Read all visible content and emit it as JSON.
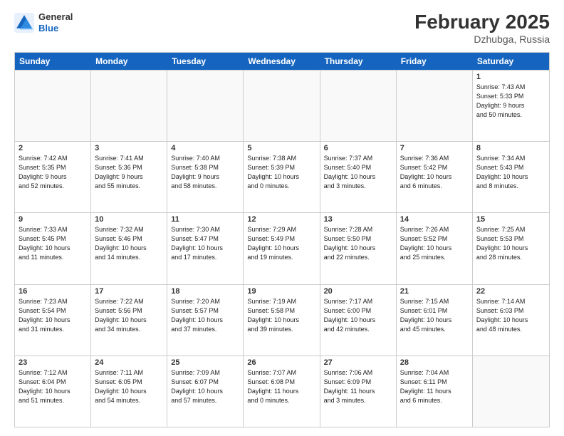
{
  "header": {
    "logo_general": "General",
    "logo_blue": "Blue",
    "month_year": "February 2025",
    "location": "Dzhubga, Russia"
  },
  "weekdays": [
    "Sunday",
    "Monday",
    "Tuesday",
    "Wednesday",
    "Thursday",
    "Friday",
    "Saturday"
  ],
  "weeks": [
    [
      {
        "day": "",
        "info": ""
      },
      {
        "day": "",
        "info": ""
      },
      {
        "day": "",
        "info": ""
      },
      {
        "day": "",
        "info": ""
      },
      {
        "day": "",
        "info": ""
      },
      {
        "day": "",
        "info": ""
      },
      {
        "day": "1",
        "info": "Sunrise: 7:43 AM\nSunset: 5:33 PM\nDaylight: 9 hours\nand 50 minutes."
      }
    ],
    [
      {
        "day": "2",
        "info": "Sunrise: 7:42 AM\nSunset: 5:35 PM\nDaylight: 9 hours\nand 52 minutes."
      },
      {
        "day": "3",
        "info": "Sunrise: 7:41 AM\nSunset: 5:36 PM\nDaylight: 9 hours\nand 55 minutes."
      },
      {
        "day": "4",
        "info": "Sunrise: 7:40 AM\nSunset: 5:38 PM\nDaylight: 9 hours\nand 58 minutes."
      },
      {
        "day": "5",
        "info": "Sunrise: 7:38 AM\nSunset: 5:39 PM\nDaylight: 10 hours\nand 0 minutes."
      },
      {
        "day": "6",
        "info": "Sunrise: 7:37 AM\nSunset: 5:40 PM\nDaylight: 10 hours\nand 3 minutes."
      },
      {
        "day": "7",
        "info": "Sunrise: 7:36 AM\nSunset: 5:42 PM\nDaylight: 10 hours\nand 6 minutes."
      },
      {
        "day": "8",
        "info": "Sunrise: 7:34 AM\nSunset: 5:43 PM\nDaylight: 10 hours\nand 8 minutes."
      }
    ],
    [
      {
        "day": "9",
        "info": "Sunrise: 7:33 AM\nSunset: 5:45 PM\nDaylight: 10 hours\nand 11 minutes."
      },
      {
        "day": "10",
        "info": "Sunrise: 7:32 AM\nSunset: 5:46 PM\nDaylight: 10 hours\nand 14 minutes."
      },
      {
        "day": "11",
        "info": "Sunrise: 7:30 AM\nSunset: 5:47 PM\nDaylight: 10 hours\nand 17 minutes."
      },
      {
        "day": "12",
        "info": "Sunrise: 7:29 AM\nSunset: 5:49 PM\nDaylight: 10 hours\nand 19 minutes."
      },
      {
        "day": "13",
        "info": "Sunrise: 7:28 AM\nSunset: 5:50 PM\nDaylight: 10 hours\nand 22 minutes."
      },
      {
        "day": "14",
        "info": "Sunrise: 7:26 AM\nSunset: 5:52 PM\nDaylight: 10 hours\nand 25 minutes."
      },
      {
        "day": "15",
        "info": "Sunrise: 7:25 AM\nSunset: 5:53 PM\nDaylight: 10 hours\nand 28 minutes."
      }
    ],
    [
      {
        "day": "16",
        "info": "Sunrise: 7:23 AM\nSunset: 5:54 PM\nDaylight: 10 hours\nand 31 minutes."
      },
      {
        "day": "17",
        "info": "Sunrise: 7:22 AM\nSunset: 5:56 PM\nDaylight: 10 hours\nand 34 minutes."
      },
      {
        "day": "18",
        "info": "Sunrise: 7:20 AM\nSunset: 5:57 PM\nDaylight: 10 hours\nand 37 minutes."
      },
      {
        "day": "19",
        "info": "Sunrise: 7:19 AM\nSunset: 5:58 PM\nDaylight: 10 hours\nand 39 minutes."
      },
      {
        "day": "20",
        "info": "Sunrise: 7:17 AM\nSunset: 6:00 PM\nDaylight: 10 hours\nand 42 minutes."
      },
      {
        "day": "21",
        "info": "Sunrise: 7:15 AM\nSunset: 6:01 PM\nDaylight: 10 hours\nand 45 minutes."
      },
      {
        "day": "22",
        "info": "Sunrise: 7:14 AM\nSunset: 6:03 PM\nDaylight: 10 hours\nand 48 minutes."
      }
    ],
    [
      {
        "day": "23",
        "info": "Sunrise: 7:12 AM\nSunset: 6:04 PM\nDaylight: 10 hours\nand 51 minutes."
      },
      {
        "day": "24",
        "info": "Sunrise: 7:11 AM\nSunset: 6:05 PM\nDaylight: 10 hours\nand 54 minutes."
      },
      {
        "day": "25",
        "info": "Sunrise: 7:09 AM\nSunset: 6:07 PM\nDaylight: 10 hours\nand 57 minutes."
      },
      {
        "day": "26",
        "info": "Sunrise: 7:07 AM\nSunset: 6:08 PM\nDaylight: 11 hours\nand 0 minutes."
      },
      {
        "day": "27",
        "info": "Sunrise: 7:06 AM\nSunset: 6:09 PM\nDaylight: 11 hours\nand 3 minutes."
      },
      {
        "day": "28",
        "info": "Sunrise: 7:04 AM\nSunset: 6:11 PM\nDaylight: 11 hours\nand 6 minutes."
      },
      {
        "day": "",
        "info": ""
      }
    ]
  ]
}
